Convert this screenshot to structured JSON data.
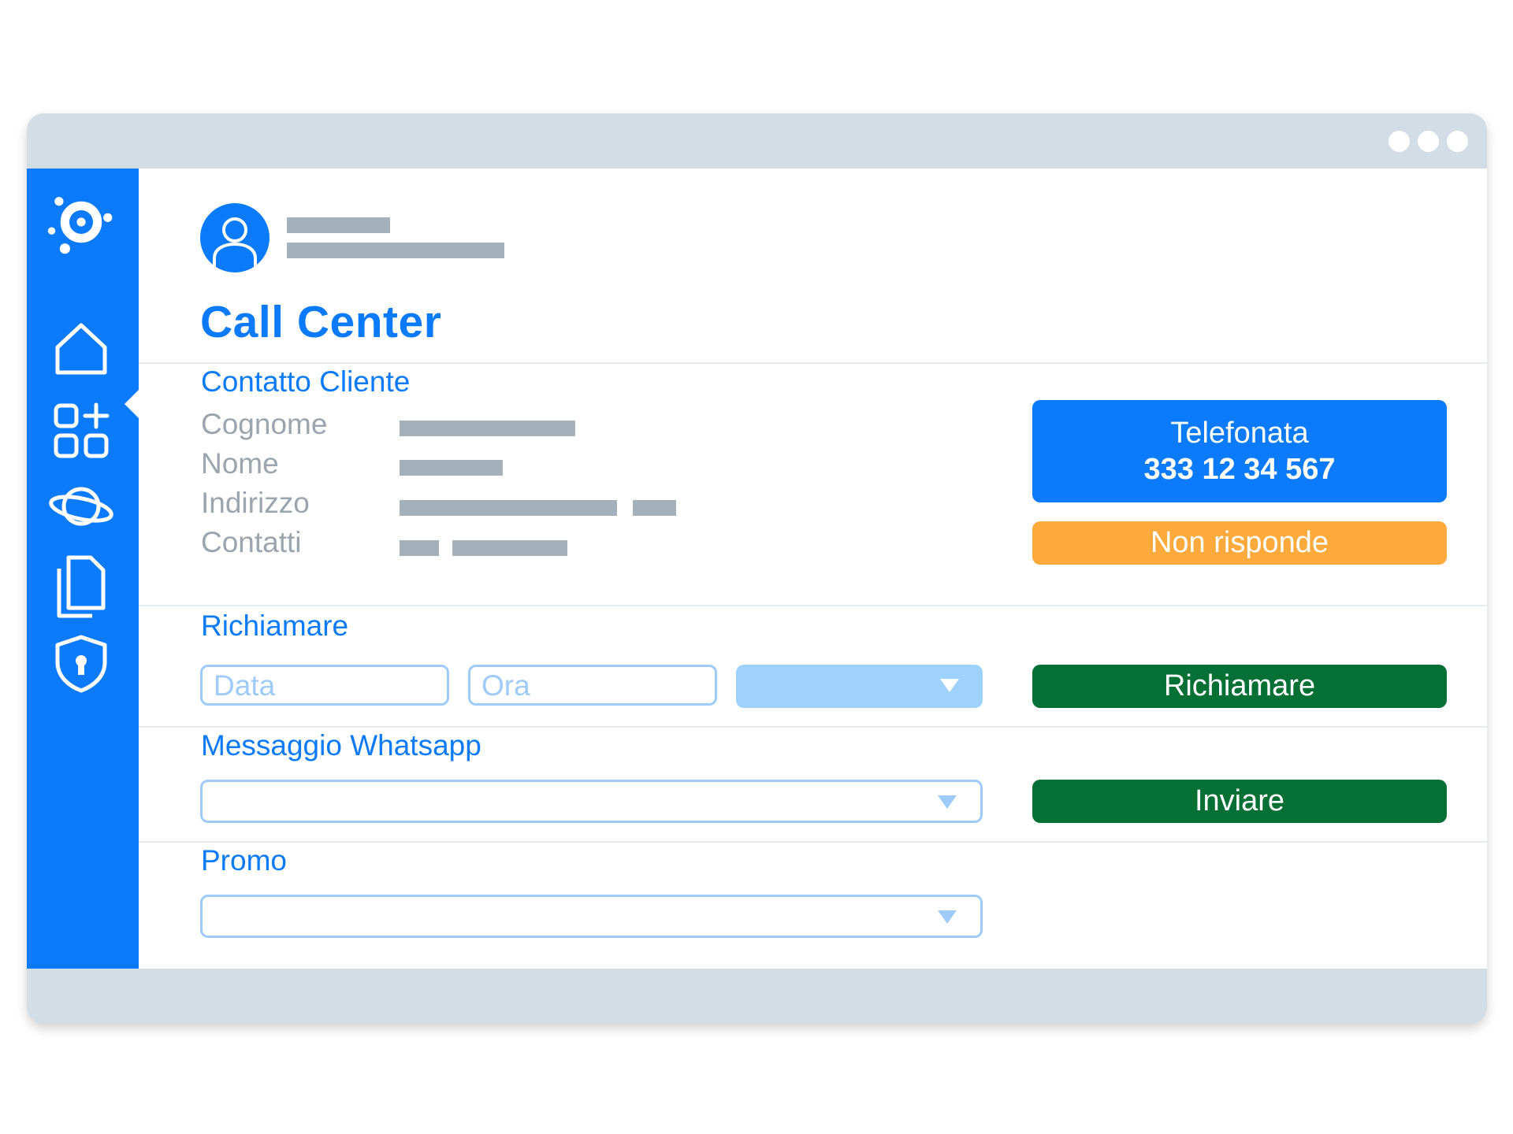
{
  "page": {
    "title": "Call Center"
  },
  "contact": {
    "section_title": "Contatto Cliente",
    "fields": [
      "Cognome",
      "Nome",
      "Indirizzo",
      "Contatti"
    ]
  },
  "call": {
    "label": "Telefonata",
    "number": "333 12 34 567",
    "no_answer_label": "Non risponde"
  },
  "callback": {
    "section_title": "Richiamare",
    "date_placeholder": "Data",
    "time_placeholder": "Ora",
    "button_label": "Richiamare"
  },
  "whatsapp": {
    "section_title": "Messaggio Whatsapp",
    "button_label": "Inviare"
  },
  "promo": {
    "section_title": "Promo"
  },
  "sidebar": {
    "icons": [
      "logo-icon",
      "home-icon",
      "apps-add-icon",
      "planet-icon",
      "documents-icon",
      "shield-lock-icon"
    ]
  },
  "colors": {
    "accent": "#0b7bfb",
    "orange": "#fda93b",
    "green": "#057035",
    "chrome": "#d3dde5"
  }
}
